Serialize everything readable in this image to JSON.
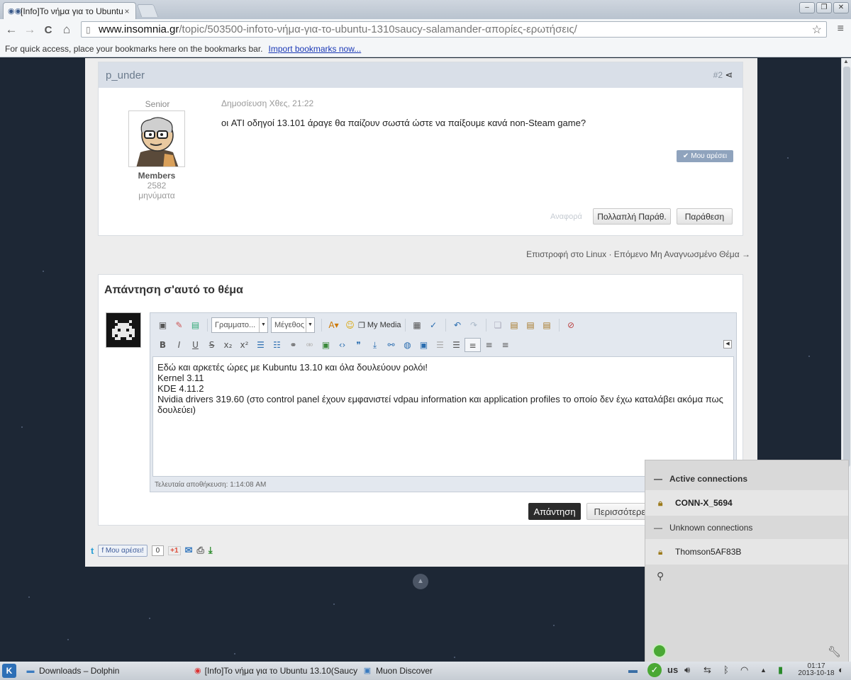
{
  "browser": {
    "tab_title": "[Info]Το νήμα για το Ubuntu",
    "tab_close": "×",
    "url_host": "www.insomnia.gr",
    "url_path": "/topic/503500-infoτο-νήμα-για-το-ubuntu-1310saucy-salamander-απορίες-ερωτήσεις/",
    "bookmarks_text": "For quick access, place your bookmarks here on the bookmarks bar.",
    "bookmarks_link": "Import bookmarks now...",
    "nav_back": "←",
    "nav_forward": "→",
    "nav_reload": "C",
    "nav_home": "⌂",
    "star": "☆",
    "menu": "≡",
    "win_min": "–",
    "win_max": "❐",
    "win_close": "✕"
  },
  "post": {
    "author": "p_under",
    "number": "#2",
    "member_title": "Senior Member",
    "group": "Members",
    "post_count": "2582 μηνύματα",
    "date": "Δημοσίευση Χθες, 21:22",
    "body": "οι ATI οδηγοί 13.101 άραγε θα παίζουν σωστά ώστε να παίξουμε κανά non-Steam game?",
    "like_label": "Μου αρέσει",
    "report_label": "Αναφορά",
    "multiquote_label": "Πολλαπλή Παράθ.",
    "quote_label": "Παράθεση"
  },
  "topic_nav": {
    "text": "Επιστροφή στο Linux · Επόμενο Μη Αναγνωσμένο Θέμα →"
  },
  "reply": {
    "title": "Απάντηση σ'αυτό το θέμα",
    "font_select": "Γραμματο...",
    "size_select": "Μέγεθος",
    "my_media": "My Media",
    "editor_lines": [
      "Εδώ και αρκετές ώρες με Kubuntu 13.10 και όλα δουλεύουν ρολόι!",
      "Kernel 3.11",
      "KDE 4.11.2",
      "Nvidia drivers 319.60 (στο control panel έχουν εμφανιστεί  vdpau information και application profiles το οποίο δεν έχω καταλάβει ακόμα πως δουλεύει)"
    ],
    "autosave": "Τελευταία αποθήκευση: 1:14:08 AM",
    "submit_label": "Απάντηση",
    "more_label": "Περισσότερες"
  },
  "social": {
    "fb_like": "Μου αρέσει!",
    "like_count": "0",
    "gplus": "+1"
  },
  "network": {
    "active_header": "Active connections",
    "active": [
      "CONN-X_5694"
    ],
    "unknown_header": "Unknown connections",
    "unknown": [
      "Thomson5AF83B"
    ],
    "dash": "—"
  },
  "taskbar": {
    "tasks": [
      "Downloads – Dolphin",
      "[Info]Το νήμα για το Ubuntu 13.10(Saucy",
      "Muon Discover"
    ],
    "layout": "us",
    "clock_time": "01:17",
    "clock_date": "2013-10-18"
  }
}
